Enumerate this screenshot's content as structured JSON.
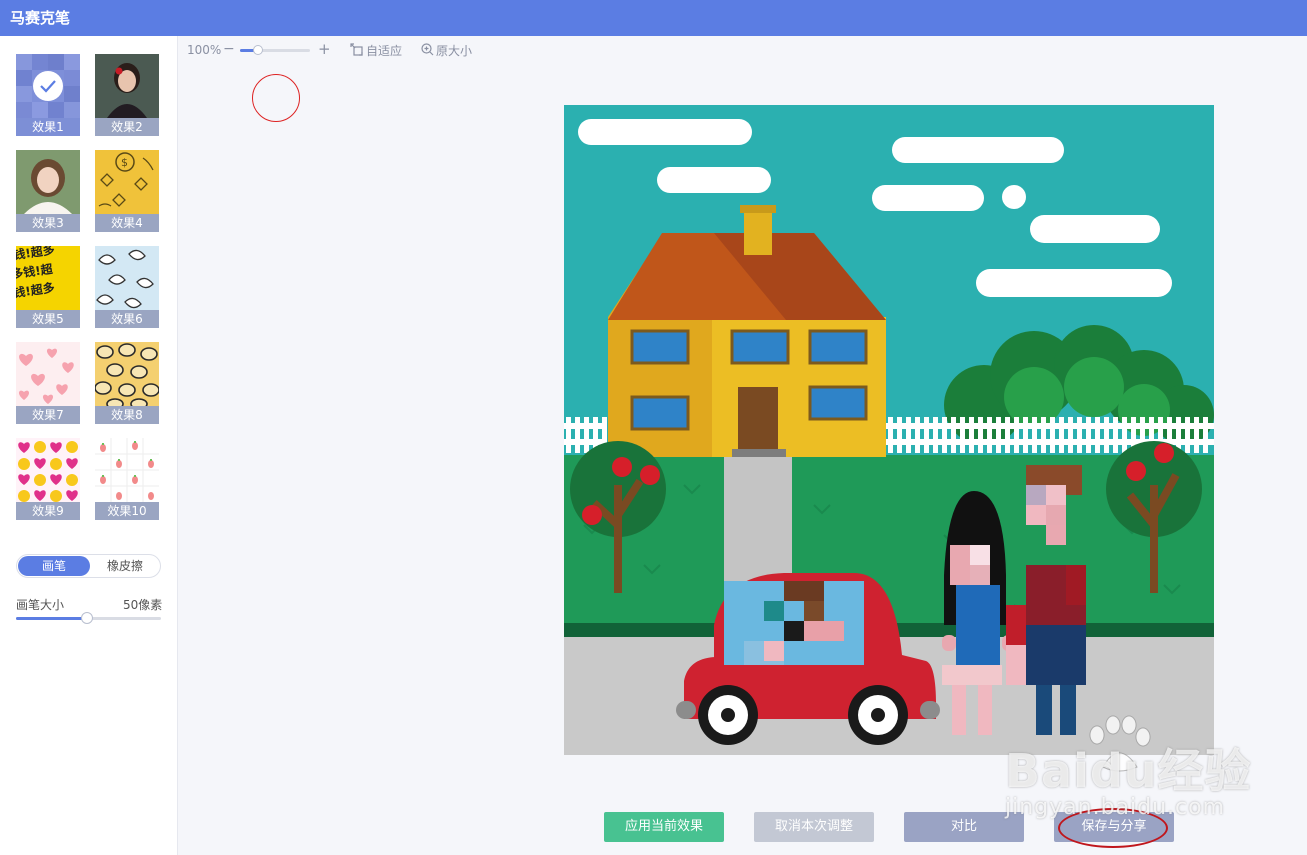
{
  "app": {
    "title": "马赛克笔"
  },
  "effects": [
    {
      "label": "效果1",
      "selected": true
    },
    {
      "label": "效果2",
      "selected": false
    },
    {
      "label": "效果3",
      "selected": false
    },
    {
      "label": "效果4",
      "selected": false
    },
    {
      "label": "效果5",
      "selected": false
    },
    {
      "label": "效果6",
      "selected": false
    },
    {
      "label": "效果7",
      "selected": false
    },
    {
      "label": "效果8",
      "selected": false
    },
    {
      "label": "效果9",
      "selected": false
    },
    {
      "label": "效果10",
      "selected": false
    }
  ],
  "tool_toggle": {
    "brush": "画笔",
    "eraser": "橡皮擦",
    "active": "brush"
  },
  "brush_size": {
    "label": "画笔大小",
    "value_text": "50像素",
    "fraction": 0.49
  },
  "toolbar": {
    "zoom_text": "100%",
    "zoom_minus": "−",
    "zoom_plus": "+",
    "zoom_fraction": 0.25,
    "fit_label": "自适应",
    "original_label": "原大小"
  },
  "actions": {
    "apply": "应用当前效果",
    "cancel": "取消本次调整",
    "compare": "对比",
    "save": "保存与分享"
  },
  "watermark": {
    "brand": "Baidu经验",
    "url": "jingyan.baidu.com"
  },
  "colors": {
    "titlebar": "#5b7de3",
    "apply": "#48c291",
    "cancel": "#c3c8d4",
    "compare": "#9aa3c4",
    "save": "#9aa3c4",
    "highlight_ring": "#c0161c"
  }
}
